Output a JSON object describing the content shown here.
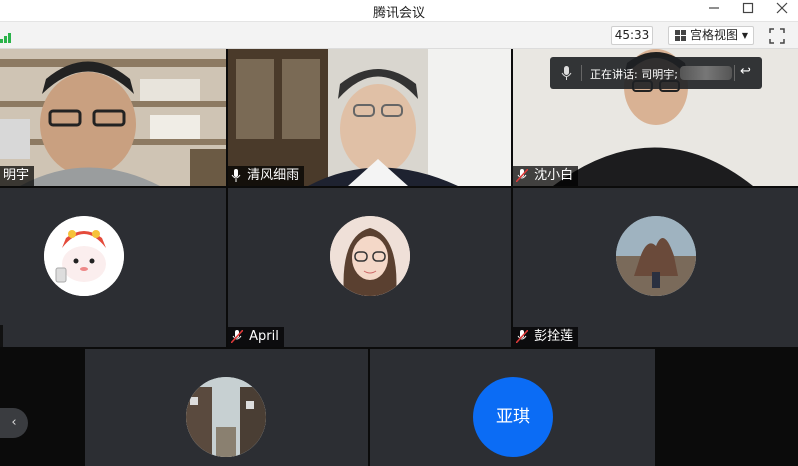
{
  "window": {
    "title": "腾讯会议"
  },
  "toolbar": {
    "timer": "45:33",
    "view_label": "宫格视图"
  },
  "participants": {
    "p1": {
      "name": "明宇"
    },
    "p2": {
      "name": "清风细雨"
    },
    "p3": {
      "name": "沈小白"
    },
    "p5": {
      "name": "April"
    },
    "p6": {
      "name": "彭拴莲"
    },
    "p9": {
      "name": "亚琪"
    }
  },
  "speaking_banner": {
    "text": "正在讲话: 司明宇;"
  },
  "colors": {
    "accent_blue": "#0b6cf5",
    "signal_green": "#2ab34a",
    "tile_bg": "#2c2e33"
  }
}
